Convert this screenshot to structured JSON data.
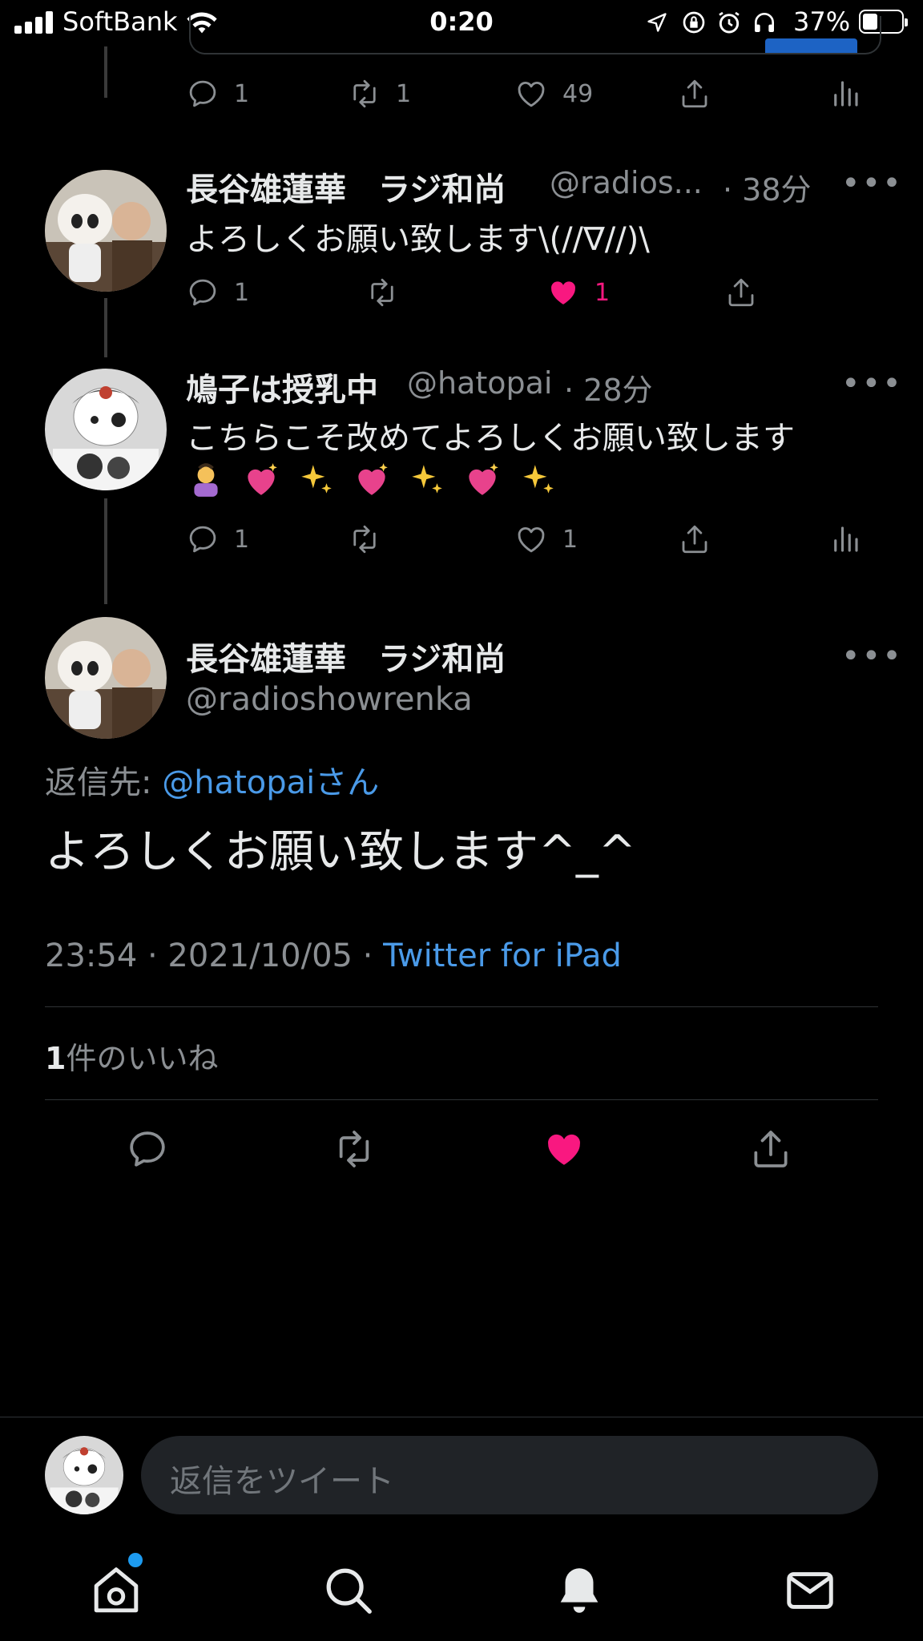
{
  "status_bar": {
    "carrier": "SoftBank",
    "time": "0:20",
    "battery": "37%"
  },
  "top_tweet_actions": {
    "reply_count": "1",
    "retweet_count": "1",
    "like_count": "49"
  },
  "tweets": [
    {
      "name": "長谷雄蓮華　ラジ和尚",
      "handle": "@radios...",
      "time": "· 38分",
      "text": "よろしくお願い致します\\(//∇//)\\",
      "reply_count": "1",
      "like_count": "1"
    },
    {
      "name": "鳩子は授乳中",
      "handle": "@hatopai",
      "time": "· 28分",
      "text": "こちらこそ改めてよろしくお願い致します",
      "reply_count": "1",
      "like_count": "1"
    }
  ],
  "main_tweet": {
    "name": "長谷雄蓮華　ラジ和尚",
    "handle": "@radioshowrenka",
    "reply_to_label": "返信先: ",
    "reply_to_user": "@hatopaiさん",
    "text": "よろしくお願い致します^_^",
    "timestamp": "23:54 · 2021/10/05 · ",
    "source": "Twitter for iPad",
    "likes_count": "1",
    "likes_label": "件のいいね"
  },
  "compose": {
    "placeholder": "返信をツイート"
  },
  "icons": [
    "reply-icon",
    "retweet-icon",
    "like-icon",
    "share-icon",
    "analytics-icon",
    "home-icon",
    "search-icon",
    "notifications-icon",
    "messages-icon"
  ],
  "colors": {
    "background": "#000000",
    "accent": "#4a9ae8",
    "like": "#f91880",
    "muted": "#8b8f93"
  }
}
